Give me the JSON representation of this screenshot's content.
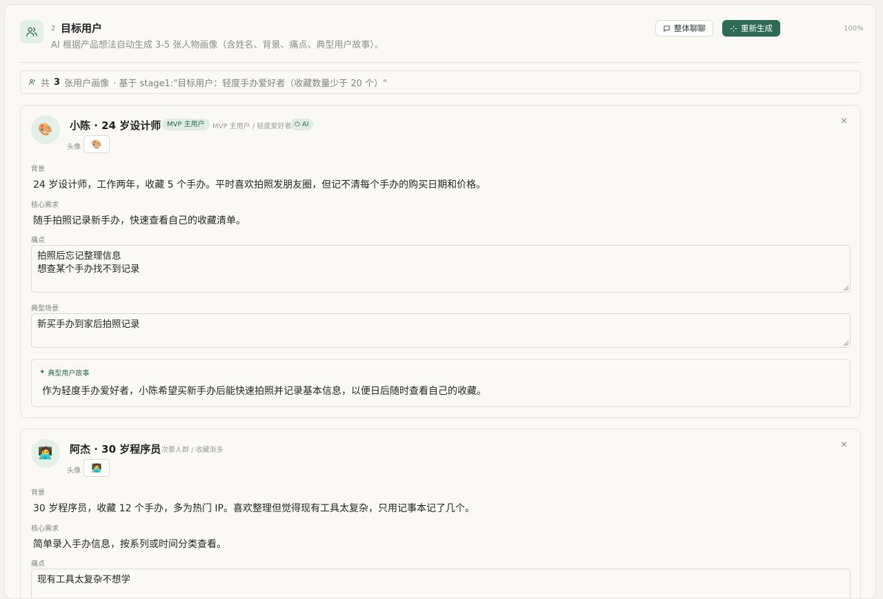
{
  "header": {
    "stage_number": "2",
    "title": "目标用户",
    "subtitle": "AI 根据产品想法自动生成 3-5 张人物画像（含姓名、背景、痛点、典型用户故事）。",
    "chat_button": "整体聊聊",
    "regen_button": "重新生成",
    "zoom": "100%"
  },
  "summary": {
    "prefix": "共",
    "count": "3",
    "suffix": "张用户画像",
    "basis": "· 基于 stage1:\"目标用户：轻度手办爱好者（收藏数量少于 20 个）\""
  },
  "labels": {
    "avatar": "头像",
    "background": "背景",
    "core_need": "核心需求",
    "pain_points": "痛点",
    "scenario": "典型场景",
    "story": "典型用户故事",
    "close": "×"
  },
  "personas": [
    {
      "name": "小陈 · 24 岁设计师",
      "avatar": "🎨",
      "mvp_badge": "MVP 主用户",
      "tagline": "MVP 主用户 / 轻度爱好者",
      "ai_badge": "AI",
      "background": "24 岁设计师，工作两年，收藏 5 个手办。平时喜欢拍照发朋友圈，但记不清每个手办的购买日期和价格。",
      "core_need": "随手拍照记录新手办，快速查看自己的收藏清单。",
      "pain_points": [
        "拍照后忘记整理信息",
        "想查某个手办找不到记录"
      ],
      "scenario": "新买手办到家后拍照记录",
      "story": "作为轻度手办爱好者，小陈希望买新手办后能快速拍照并记录基本信息，以便日后随时查看自己的收藏。"
    },
    {
      "name": "阿杰 · 30 岁程序员",
      "avatar": "🧑‍💻",
      "tagline": "次要人群 / 收藏渐多",
      "background": "30 岁程序员，收藏 12 个手办，多为热门 IP。喜欢整理但觉得现有工具太复杂，只用记事本记了几个。",
      "core_need": "简单录入手办信息，按系列或时间分类查看。",
      "pain_points": [
        "现有工具太复杂不想学"
      ]
    }
  ],
  "colors": {
    "accent": "#2c6b55",
    "accent_soft": "#dfece6",
    "page_bg": "#f3f2ee"
  }
}
